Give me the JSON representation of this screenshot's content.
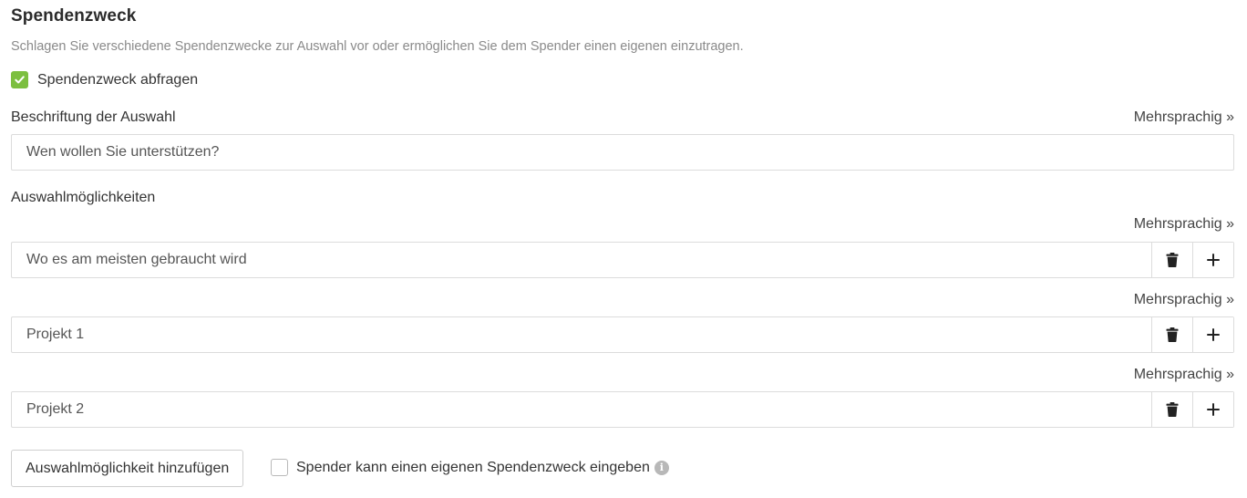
{
  "section": {
    "title": "Spendenzweck",
    "description": "Schlagen Sie verschiedene Spendenzwecke zur Auswahl vor oder ermöglichen Sie dem Spender einen eigenen einzutragen."
  },
  "ask_purpose": {
    "label": "Spendenzweck abfragen",
    "checked": true
  },
  "selection_label": {
    "label": "Beschriftung der Auswahl",
    "multilingual_link": "Mehrsprachig »",
    "value": "Wen wollen Sie unterstützen?"
  },
  "options": {
    "label": "Auswahlmöglichkeiten",
    "multilingual_link": "Mehrsprachig »",
    "items": [
      {
        "value": "Wo es am meisten gebraucht wird"
      },
      {
        "value": "Projekt 1"
      },
      {
        "value": "Projekt 2"
      }
    ],
    "add_button": "Auswahlmöglichkeit hinzufügen"
  },
  "own_purpose": {
    "label": "Spender kann einen eigenen Spendenzweck eingeben",
    "checked": false,
    "info_icon": "i"
  },
  "colors": {
    "accent_green": "#7cbf3f",
    "border": "#dcdcdc",
    "muted_text": "#8a8a8a"
  },
  "icons": {
    "checkmark": "check-icon",
    "delete": "trash-icon",
    "add": "plus-icon",
    "info": "info-icon"
  }
}
